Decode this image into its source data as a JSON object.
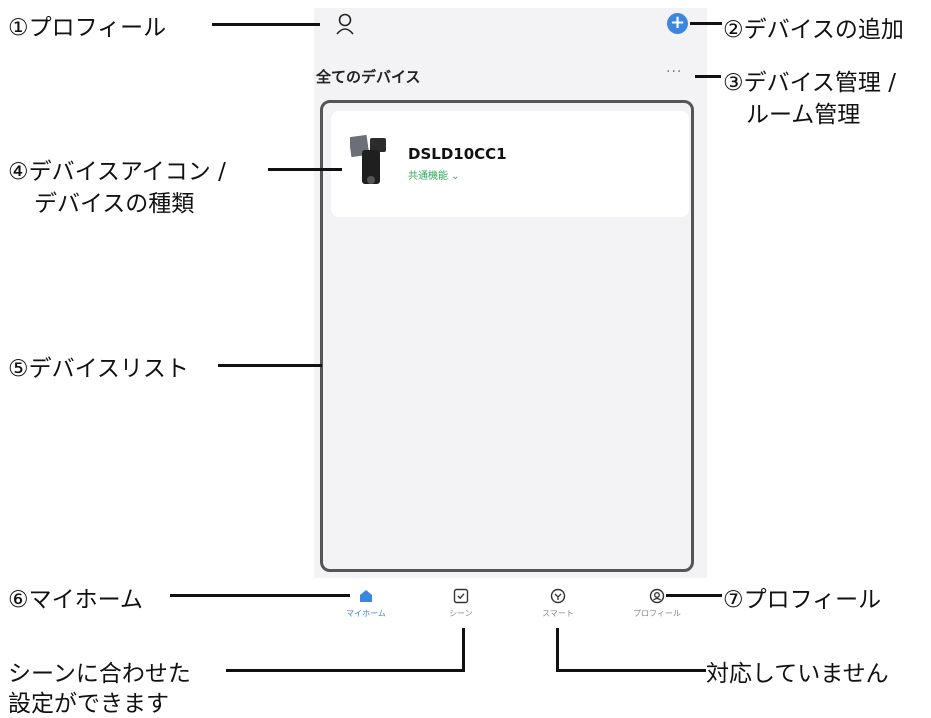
{
  "screen": {
    "title": "全てのデバイス",
    "more_label": "···",
    "add_label": "+"
  },
  "device": {
    "name": "DSLD10CC1",
    "type_label": "共通機能 ⌄"
  },
  "tabs": [
    {
      "label": "マイホーム",
      "icon": "home-icon",
      "active": true
    },
    {
      "label": "シーン",
      "icon": "scene-icon",
      "active": false
    },
    {
      "label": "スマート",
      "icon": "smart-icon",
      "active": false
    },
    {
      "label": "プロフィール",
      "icon": "profile-icon",
      "active": false
    }
  ],
  "annotations": {
    "a1": "①プロフィール",
    "a2": "②デバイスの追加",
    "a3_line1": "③デバイス管理 /",
    "a3_line2": "ルーム管理",
    "a4_line1": "④デバイスアイコン /",
    "a4_line2": "デバイスの種類",
    "a5": "⑤デバイスリスト",
    "a6": "⑥マイホーム",
    "a7": "⑦プロフィール",
    "scene_note_line1": "シーンに合わせた",
    "scene_note_line2": "設定ができます",
    "smart_note": "対応していません"
  },
  "colors": {
    "accent": "#3d86e0",
    "screen_bg": "#f3f3f5",
    "type_green": "#2faa5a"
  }
}
